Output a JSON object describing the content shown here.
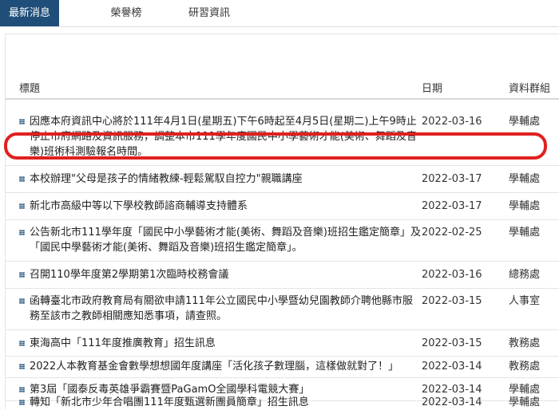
{
  "tabs": [
    "最新消息",
    "榮譽榜",
    "研習資訊"
  ],
  "table": {
    "headers": {
      "title": "標題",
      "date": "日期",
      "group": "資料群組"
    },
    "rows": [
      {
        "title": "因應本府資訊中心將於111年4月1日(星期五)下午6時起至4月5日(星期二)上午9時止停止市府網路及資訊服務，調整本市111學年度國民中小學藝術才能(美術、舞蹈及音樂)班術科測驗報名時間。",
        "date": "2022-03-16",
        "group": "學輔處"
      },
      {
        "title": "本校辦理\"父母是孩子的情緒教練-輕鬆駕馭自控力\"親職講座",
        "date": "2022-03-17",
        "group": "學輔處"
      },
      {
        "title": "新北市高級中等以下學校教師諮商輔導支持體系",
        "date": "2022-03-17",
        "group": "學輔處"
      },
      {
        "title": "公告新北市111學年度「國民中小學藝術才能(美術、舞蹈及音樂)班招生鑑定簡章」及「國民中學藝術才能(美術、舞蹈及音樂)班招生鑑定簡章」。",
        "date": "2022-02-25",
        "group": "學輔處"
      },
      {
        "title": "召開110學年度第2學期第1次臨時校務會議",
        "date": "2022-03-16",
        "group": "總務處"
      },
      {
        "title": "函轉臺北市政府教育局有關欲申請111年公立國民中小學暨幼兒園教師介聘他縣市服務至該市之教師相關應知悉事項，請查照。",
        "date": "2022-03-15",
        "group": "人事室"
      },
      {
        "title": "東海高中「111年度推廣教育」招生訊息",
        "date": "2022-03-15",
        "group": "教務處"
      },
      {
        "title": "2022人本教育基金會數學想想國年度講座「活化孩子數理腦，這樣做就對了！」",
        "date": "2022-03-14",
        "group": "教務處"
      },
      {
        "title": "第3屆「國泰反毒英雄爭霸賽暨PaGamO全國學科電競大賽」",
        "date": "2022-03-14",
        "group": "學輔處"
      },
      {
        "title": "轉知「新北市少年合唱團111年度甄選新團員簡章」招生訊息",
        "date": "2022-03-14",
        "group": "學輔處"
      }
    ]
  },
  "colors": {
    "tab_active": "#1f4e79",
    "highlight": "#e0201e",
    "bullet": "#1f4e79"
  }
}
